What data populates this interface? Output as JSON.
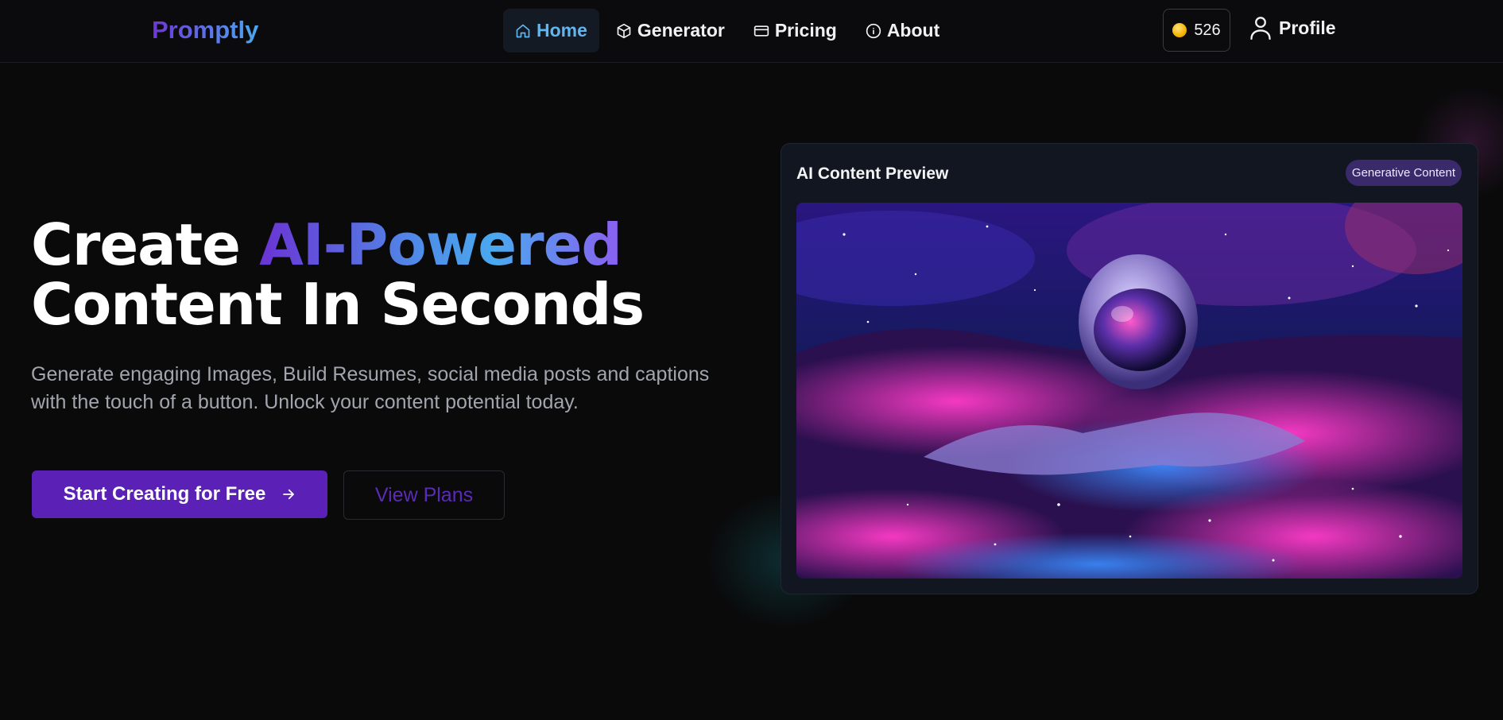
{
  "nav": {
    "logo": "Promptly",
    "links": [
      {
        "label": "Home",
        "icon": "home-icon",
        "active": true
      },
      {
        "label": "Generator",
        "icon": "cube-icon",
        "active": false
      },
      {
        "label": "Pricing",
        "icon": "credit-card-icon",
        "active": false
      },
      {
        "label": "About",
        "icon": "info-icon",
        "active": false
      }
    ],
    "credits": "526",
    "credits_icon": "coin-icon",
    "profile_label": "Profile",
    "profile_icon": "user-icon"
  },
  "hero": {
    "headline_plain": "Create ",
    "headline_highlight": "AI-Powered",
    "headline_line2": "Content In Seconds",
    "subtext": "Generate engaging Images, Build Resumes, social media posts and captions with the touch of a button. Unlock your content potential today.",
    "primary_cta": "Start Creating for Free",
    "primary_cta_icon": "arrow-right-icon",
    "secondary_cta": "View Plans"
  },
  "preview": {
    "title": "AI Content Preview",
    "badge": "Generative Content",
    "image_subject": "astronaut-in-cosmic-nebula-image"
  },
  "colors": {
    "background": "#0a0a0b",
    "accent_purple": "#5b21b6",
    "accent_blue": "#5fb6f0",
    "badge_bg": "#3b2a6b",
    "coin": "#f5b400"
  }
}
